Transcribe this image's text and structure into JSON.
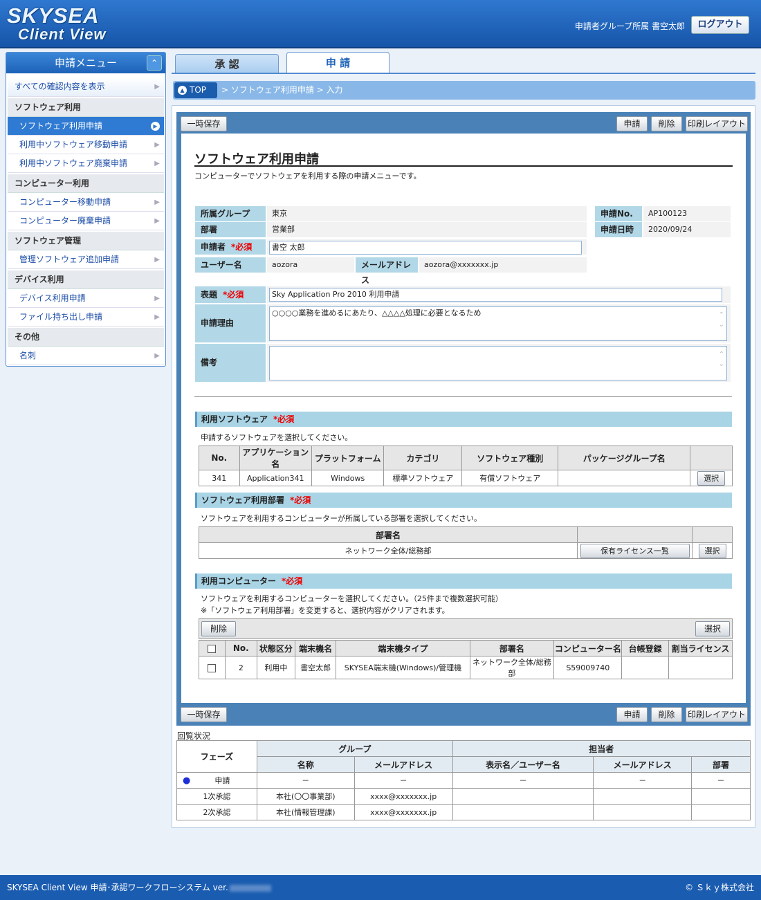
{
  "header": {
    "logo_line1": "SKYSEA",
    "logo_line2": "Client View",
    "user": "申請者グループ所属  書空太郎",
    "logout": "ログアウト"
  },
  "sidebar": {
    "title": "申請メニュー",
    "show_all": "すべての確認内容を表示",
    "categories": [
      {
        "label": "ソフトウェア利用",
        "items": [
          "ソフトウェア利用申請",
          "利用中ソフトウェア移動申請",
          "利用中ソフトウェア廃棄申請"
        ]
      },
      {
        "label": "コンピューター利用",
        "items": [
          "コンピューター移動申請",
          "コンピューター廃棄申請"
        ]
      },
      {
        "label": "ソフトウェア管理",
        "items": [
          "管理ソフトウェア追加申請"
        ]
      },
      {
        "label": "デバイス利用",
        "items": [
          "デバイス利用申請",
          "ファイル持ち出し申請"
        ]
      },
      {
        "label": "その他",
        "items": [
          "名刺"
        ]
      }
    ]
  },
  "tabs": {
    "approve": "承 認",
    "apply": "申 請"
  },
  "breadcrumb": {
    "top": "TOP",
    "path": ">  ソフトウェア利用申請  >  入力"
  },
  "buttons": {
    "save": "一時保存",
    "apply": "申請",
    "delete": "削除",
    "print": "印刷レイアウト",
    "select": "選択",
    "license_list": "保有ライセンス一覧",
    "remove": "削除"
  },
  "form": {
    "title": "ソフトウェア利用申請",
    "description": "コンピューターでソフトウェアを利用する際の申請メニューです。",
    "group_label": "所属グループ",
    "group": "東京",
    "dept_label": "部署",
    "dept": "営業部",
    "applicant_label": "申請者",
    "applicant": "書空 太郎",
    "required": "*必須",
    "user_label": "ユーザー名",
    "user": "aozora",
    "mail_label": "メールアドレス",
    "mail": "aozora@xxxxxxx.jp",
    "no_label": "申請No.",
    "no": "AP100123",
    "date_label": "申請日時",
    "date": "2020/09/24",
    "subject_label": "表題",
    "subject": "Sky Application Pro 2010 利用申請",
    "reason_label": "申請理由",
    "reason": "○○○○業務を進めるにあたり、△△△△処理に必要となるため",
    "remarks_label": "備考",
    "remarks": ""
  },
  "software": {
    "title": "利用ソフトウェア",
    "note": "申請するソフトウェアを選択してください。",
    "headers": [
      "No.",
      "アプリケーション名",
      "プラットフォーム",
      "カテゴリ",
      "ソフトウェア種別",
      "パッケージグループ名"
    ],
    "row": [
      "341",
      "Application341",
      "Windows",
      "標準ソフトウェア",
      "有償ソフトウェア",
      ""
    ]
  },
  "dept_section": {
    "title": "ソフトウェア利用部署",
    "note": "ソフトウェアを利用するコンピューターが所属している部署を選択してください。",
    "header": "部署名",
    "value": "ネットワーク全体/総務部"
  },
  "computers": {
    "title": "利用コンピューター",
    "note1": "ソフトウェアを利用するコンピューターを選択してください。（25件まで複数選択可能）",
    "note2": "※「ソフトウェア利用部署」を変更すると、選択内容がクリアされます。",
    "headers": [
      "No.",
      "状態区分",
      "端末機名",
      "端末機タイプ",
      "部署名",
      "コンピューター名",
      "台帳登録",
      "割当ライセンス"
    ],
    "row": [
      "2",
      "利用中",
      "書空太郎",
      "SKYSEA端末機(Windows)/管理機",
      "ネットワーク全体/総務部",
      "S59009740",
      "",
      ""
    ]
  },
  "circulation": {
    "title": "回覧状況",
    "phase": "フェーズ",
    "group": "グループ",
    "person": "担当者",
    "name": "名称",
    "mail": "メールアドレス",
    "display": "表示名／ユーザー名",
    "dept": "部署",
    "rows": [
      {
        "phase": "申請",
        "name": "－",
        "mail": "－",
        "display": "－",
        "pmail": "－",
        "dept": "－"
      },
      {
        "phase": "1次承認",
        "name": "本社(〇〇事業部)",
        "mail": "xxxx@xxxxxxx.jp",
        "display": "",
        "pmail": "",
        "dept": ""
      },
      {
        "phase": "2次承認",
        "name": "本社(情報管理課)",
        "mail": "xxxx@xxxxxxx.jp",
        "display": "",
        "pmail": "",
        "dept": ""
      }
    ]
  },
  "footer": {
    "left": "SKYSEA Client View 申請･承認ワークフローシステム ver.",
    "right": "© Ｓｋｙ株式会社"
  },
  "colors": {
    "header": "#1f63bb",
    "label_bg": "#b2d8e8",
    "required": "#ee0000"
  }
}
